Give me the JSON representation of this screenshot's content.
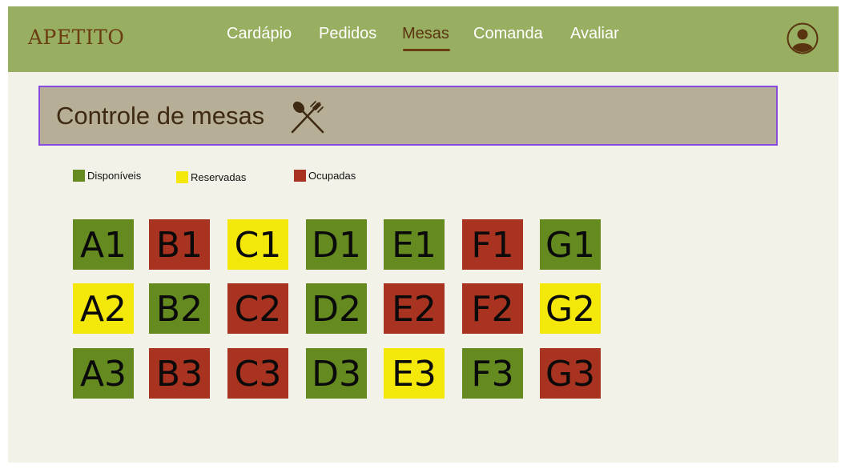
{
  "app": {
    "brand": "APETITO"
  },
  "nav": {
    "items": [
      {
        "label": "Cardápio",
        "active": false
      },
      {
        "label": "Pedidos",
        "active": false
      },
      {
        "label": "Mesas",
        "active": true
      },
      {
        "label": "Comanda",
        "active": false
      },
      {
        "label": "Avaliar",
        "active": false
      }
    ],
    "user_icon": "user-avatar-icon"
  },
  "header": {
    "title": "Controle de mesas",
    "icon": "cutlery-icon"
  },
  "legend": [
    {
      "label": "Disponíveis",
      "color": "#658a20"
    },
    {
      "label": "Reservadas",
      "color": "#f3e80a"
    },
    {
      "label": "Ocupadas",
      "color": "#a83320"
    }
  ],
  "status_colors": {
    "available": "#658a20",
    "reserved": "#f3e80a",
    "occupied": "#a83320"
  },
  "tables": [
    {
      "id": "A1",
      "status": "available"
    },
    {
      "id": "B1",
      "status": "occupied"
    },
    {
      "id": "C1",
      "status": "reserved"
    },
    {
      "id": "D1",
      "status": "available"
    },
    {
      "id": "E1",
      "status": "available"
    },
    {
      "id": "F1",
      "status": "occupied"
    },
    {
      "id": "G1",
      "status": "available"
    },
    {
      "id": "A2",
      "status": "reserved"
    },
    {
      "id": "B2",
      "status": "available"
    },
    {
      "id": "C2",
      "status": "occupied"
    },
    {
      "id": "D2",
      "status": "available"
    },
    {
      "id": "E2",
      "status": "occupied"
    },
    {
      "id": "F2",
      "status": "occupied"
    },
    {
      "id": "G2",
      "status": "reserved"
    },
    {
      "id": "A3",
      "status": "available"
    },
    {
      "id": "B3",
      "status": "occupied"
    },
    {
      "id": "C3",
      "status": "occupied"
    },
    {
      "id": "D3",
      "status": "available"
    },
    {
      "id": "E3",
      "status": "reserved"
    },
    {
      "id": "F3",
      "status": "available"
    },
    {
      "id": "G3",
      "status": "occupied"
    }
  ]
}
